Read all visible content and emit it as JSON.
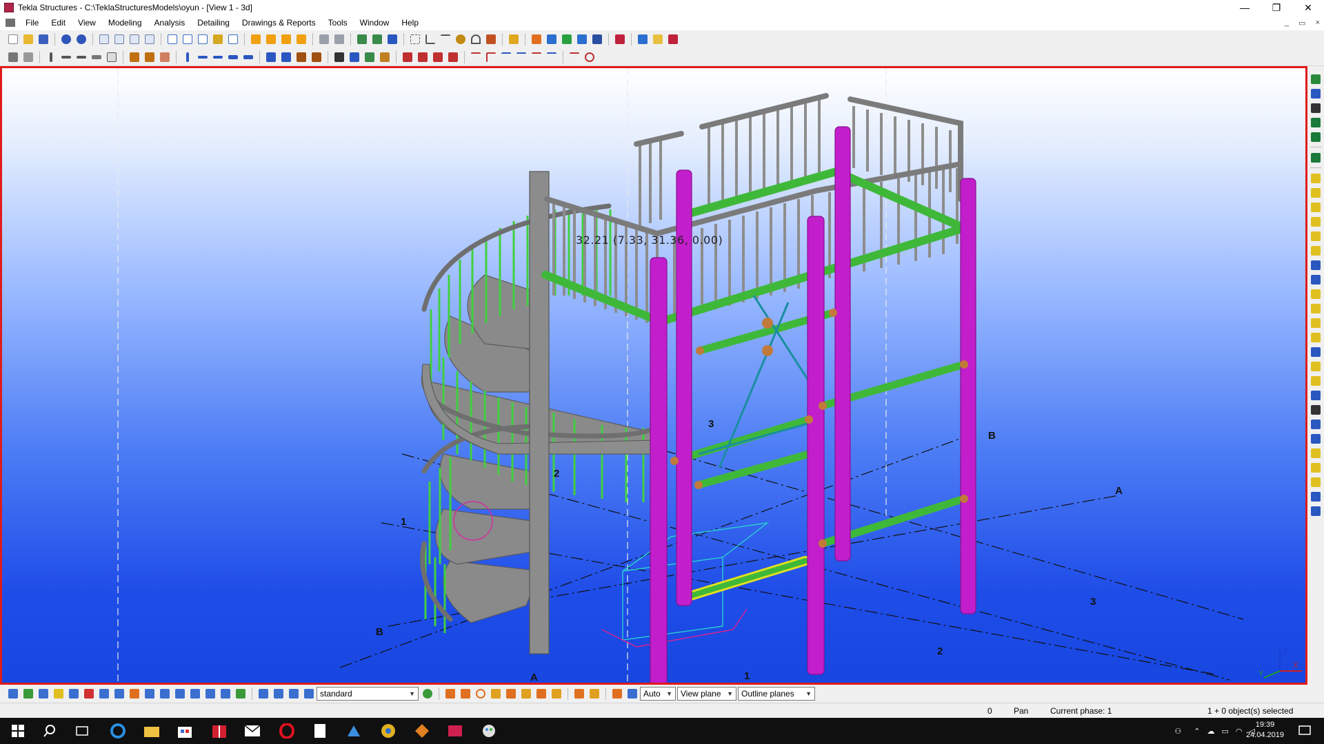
{
  "window": {
    "title": "Tekla Structures - C:\\TeklaStructuresModels\\oyun - [View 1 - 3d]",
    "minimize_glyph": "—",
    "restore_glyph": "❐",
    "close_glyph": "✕"
  },
  "menu": {
    "items": [
      "File",
      "Edit",
      "View",
      "Modeling",
      "Analysis",
      "Detailing",
      "Drawings & Reports",
      "Tools",
      "Window",
      "Help"
    ],
    "child_minimize_glyph": "_",
    "child_restore_glyph": "▭",
    "child_close_glyph": "×"
  },
  "viewport": {
    "coordinate_readout": "32.21  (7.33,  31.36,  0.00)",
    "grid_labels": [
      "1",
      "2",
      "3",
      "A",
      "B",
      "B",
      "A",
      "3",
      "2",
      "1"
    ],
    "axis_labels": {
      "x": "X",
      "y": "Y",
      "z": "Z"
    },
    "colors": {
      "border": "#e01b1b",
      "steel_gray": "#8f8f8f",
      "column_magenta": "#c21ecc",
      "beam_green": "#3fb83a",
      "rail_green": "#4fd04a",
      "bracing_teal": "#1a8ea0"
    }
  },
  "bottom_toolbar": {
    "selection_setting": "standard",
    "snap_depth": "Auto",
    "plane": "View plane",
    "plane_type": "Outline planes"
  },
  "status": {
    "value": "0",
    "mode": "Pan",
    "current_phase": "Current phase: 1",
    "selection": "1 + 0 object(s) selected"
  },
  "taskbar": {
    "time": "19:39",
    "date": "24.04.2019",
    "icons": [
      "windows-start-icon",
      "search-icon",
      "task-view-icon",
      "edge-icon",
      "file-explorer-icon",
      "store-icon",
      "gift-icon",
      "mail-icon",
      "opera-icon",
      "document-icon",
      "app-icon",
      "chrome-icon",
      "game-icon",
      "tekla-icon",
      "paint-icon"
    ]
  }
}
